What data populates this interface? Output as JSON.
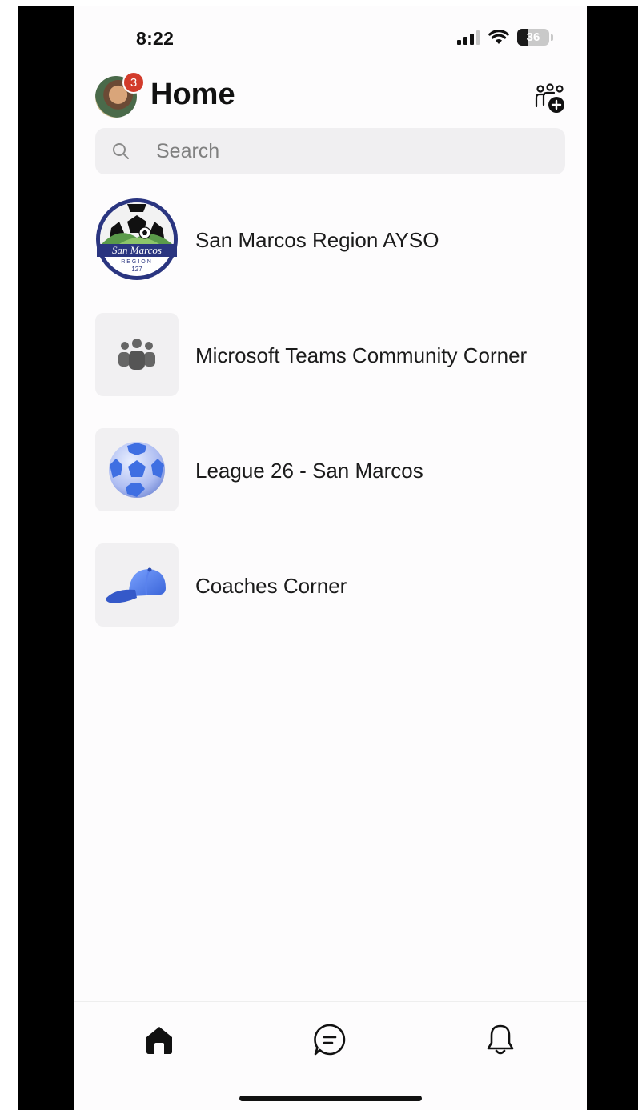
{
  "status_bar": {
    "time": "8:22",
    "battery": "36",
    "battery_level": 0.36
  },
  "header": {
    "title": "Home",
    "notification_count": "3"
  },
  "search": {
    "placeholder": "Search"
  },
  "teams": [
    {
      "name": "San Marcos Region AYSO",
      "logo_text": "San Marcos",
      "logo_sub": "REGION",
      "logo_num": "127"
    },
    {
      "name": "Microsoft Teams Community Corner",
      "icon": "people-group-icon"
    },
    {
      "name": "League 26 - San Marcos",
      "icon": "soccer-ball-icon"
    },
    {
      "name": "Coaches Corner",
      "icon": "baseball-cap-icon"
    }
  ],
  "nav": [
    {
      "icon": "home-icon",
      "active": true
    },
    {
      "icon": "chat-icon",
      "active": false
    },
    {
      "icon": "bell-icon",
      "active": false
    }
  ],
  "colors": {
    "badge": "#d23b2b",
    "accent_blue": "#4a7ee8",
    "logo_navy": "#2a3580"
  }
}
